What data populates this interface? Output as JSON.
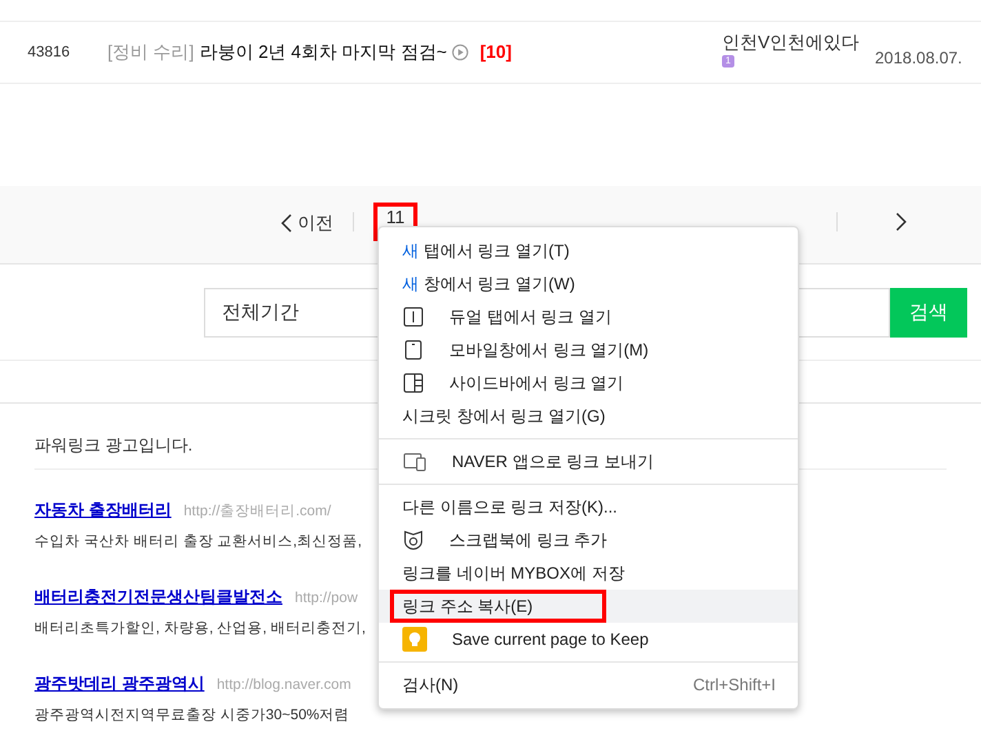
{
  "post_row": {
    "number": "43816",
    "category": "[정비 수리]",
    "title": "라붕이 2년 4회차 마지막 점검~",
    "comments": "[10]",
    "author": "인천V인천에있다",
    "author_badge": "1",
    "date": "2018.08.07."
  },
  "pagination": {
    "prev": "이전",
    "pages": [
      {
        "label": "11",
        "selected": false,
        "annotated": true
      }
    ]
  },
  "search": {
    "period": "전체기간",
    "button": "검색"
  },
  "ads": {
    "heading": "파워링크 광고입니다.",
    "items": [
      {
        "title": "자동차 출장배터리",
        "url": "http://출장배터리.com/",
        "description": "수입차 국산차 배터리 출장 교환서비스,최신정품,"
      },
      {
        "title": "배터리충전기전문생산팀클발전소",
        "url": "http://pow",
        "description": "배터리초특가할인, 차량용, 산업용, 배터리충전기,"
      },
      {
        "title": "광주밧데리 광주광역시",
        "url": "http://blog.naver.com",
        "description": "광주광역시전지역무료출장 시중가30~50%저렴"
      }
    ]
  },
  "context_menu": {
    "groups": [
      [
        {
          "accent": "새",
          "label": " 탭에서 링크 열기(T)",
          "kind": "plain",
          "hovered": false,
          "annotated": false
        },
        {
          "accent": "새",
          "label": " 창에서 링크 열기(W)",
          "kind": "plain",
          "hovered": false,
          "annotated": false
        },
        {
          "label": "듀얼 탭에서 링크 열기",
          "kind": "dual",
          "hovered": false,
          "annotated": false
        },
        {
          "label": "모바일창에서 링크 열기(M)",
          "kind": "mobile",
          "hovered": false,
          "annotated": false
        },
        {
          "label": "사이드바에서 링크 열기",
          "kind": "sidebar",
          "hovered": false,
          "annotated": false
        },
        {
          "label": "시크릿 창에서 링크 열기(G)",
          "kind": "plain",
          "hovered": false,
          "annotated": false
        }
      ],
      [
        {
          "label": "NAVER 앱으로 링크 보내기",
          "kind": "devices",
          "hovered": false,
          "annotated": false
        }
      ],
      [
        {
          "label": "다른 이름으로 링크 저장(K)...",
          "kind": "plain",
          "hovered": false,
          "annotated": false
        },
        {
          "label": "스크랩북에 링크 추가",
          "kind": "scrap",
          "hovered": false,
          "annotated": false
        },
        {
          "label": "링크를 네이버 MYBOX에 저장",
          "kind": "plain",
          "hovered": false,
          "annotated": false
        },
        {
          "label": "링크 주소 복사(E)",
          "kind": "plain",
          "hovered": true,
          "annotated": true
        },
        {
          "label": "Save current page to Keep",
          "kind": "keep",
          "hovered": false,
          "annotated": false
        }
      ],
      [
        {
          "label": "검사(N)",
          "shortcut": "Ctrl+Shift+I",
          "kind": "plain",
          "hovered": false,
          "annotated": false
        }
      ]
    ]
  }
}
